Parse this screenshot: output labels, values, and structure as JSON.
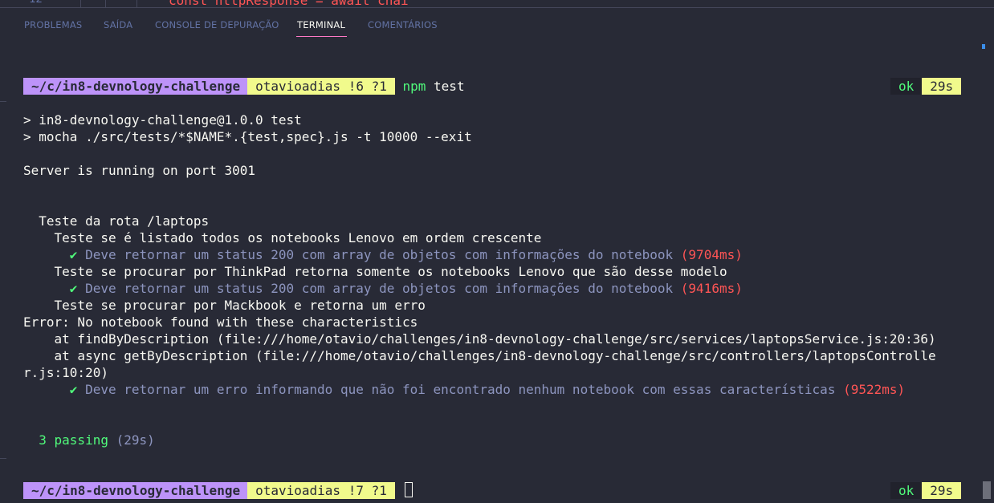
{
  "editor": {
    "line_number": "12",
    "code_fragment": "const httpResponse = await chai"
  },
  "tabs": [
    {
      "label": "PROBLEMAS"
    },
    {
      "label": "SAÍDA"
    },
    {
      "label": "CONSOLE DE DEPURAÇÃO"
    },
    {
      "label": "TERMINAL",
      "active": true
    },
    {
      "label": "COMENTÁRIOS"
    }
  ],
  "prompt1": {
    "path": "~/c/in8-devnology-challenge",
    "git": "otavioadias !6 ?1",
    "command_name": "npm",
    "command_args": " test",
    "status": "ok",
    "duration": "29s"
  },
  "output": {
    "npm_line1": "> in8-devnology-challenge@1.0.0 test",
    "npm_line2": "> mocha ./src/tests/*$NAME*.{test,spec}.js -t 10000 --exit",
    "server": "Server is running on port 3001",
    "suite": "  Teste da rota /laptops",
    "test1_title": "    Teste se é listado todos os notebooks Lenovo em ordem crescente",
    "test1_check": "      ✔ ",
    "test1_desc": "Deve retornar um status 200 com array de objetos com informações do notebook",
    "test1_time": " (9704ms)",
    "test2_title": "    Teste se procurar por ThinkPad retorna somente os notebooks Lenovo que são desse modelo",
    "test2_check": "      ✔ ",
    "test2_desc": "Deve retornar um status 200 com array de objetos com informações do notebook",
    "test2_time": " (9416ms)",
    "test3_title": "    Teste se procurar por Mackbook e retorna um erro",
    "error_line": "Error: No notebook found with these characteristics",
    "stack1": "    at findByDescription (file:///home/otavio/challenges/in8-devnology-challenge/src/services/laptopsService.js:20:36)",
    "stack2": "    at async getByDescription (file:///home/otavio/challenges/in8-devnology-challenge/src/controllers/laptopsControlle",
    "stack3": "r.js:10:20)",
    "test3_check": "      ✔ ",
    "test3_desc": "Deve retornar um erro informando que não foi encontrado nenhum notebook com essas características",
    "test3_time": " (9522ms)",
    "passing": "  3 passing",
    "passing_time": " (29s)"
  },
  "prompt2": {
    "path": "~/c/in8-devnology-challenge",
    "git": "otavioadias !7 ?1",
    "status": "ok",
    "duration": "29s"
  },
  "colors": {
    "background": "#282a36",
    "path_segment": "#bd93f9",
    "git_segment": "#f1fa8c",
    "success": "#50fa7b",
    "error": "#ff5555",
    "active_tab_border": "#ff79c6"
  }
}
